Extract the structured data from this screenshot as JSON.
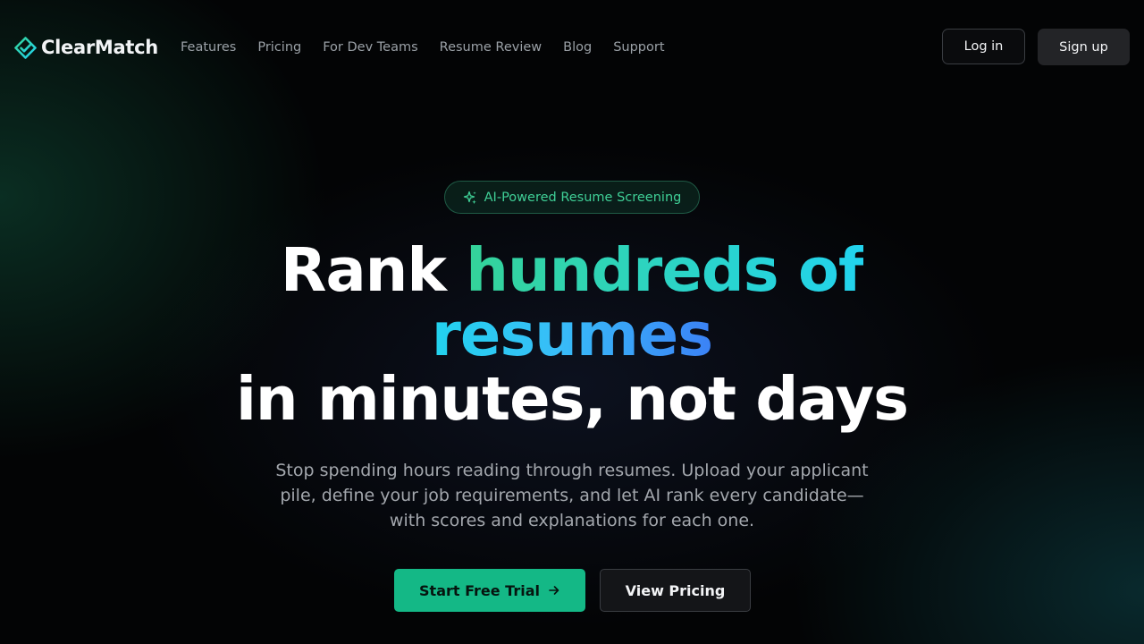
{
  "nav": {
    "logo_text": "ClearMatch",
    "links": [
      "Features",
      "Pricing",
      "For Dev Teams",
      "Resume Review",
      "Blog",
      "Support"
    ],
    "login_label": "Log in",
    "signup_label": "Sign up"
  },
  "hero": {
    "badge_text": "AI-Powered Resume Screening",
    "badge_icon": "sparkles-icon",
    "headline": {
      "part1": "Rank ",
      "highlight1": "hundreds of",
      "highlight2": "resumes",
      "part3": "in minutes, not days"
    },
    "subtext": "Stop spending hours reading through resumes. Upload your applicant pile, define your job requirements, and let AI rank every candidate—with scores and explanations for each one.",
    "primary_cta": "Start Free Trial",
    "primary_cta_icon": "arrow-right-icon",
    "secondary_cta": "View Pricing"
  },
  "colors": {
    "accent": "#14b886",
    "badge_text": "#3fcf96",
    "gradient_start": "#34d399",
    "gradient_mid": "#22d3ee",
    "gradient_end": "#3b82f6",
    "background": "#030405"
  }
}
